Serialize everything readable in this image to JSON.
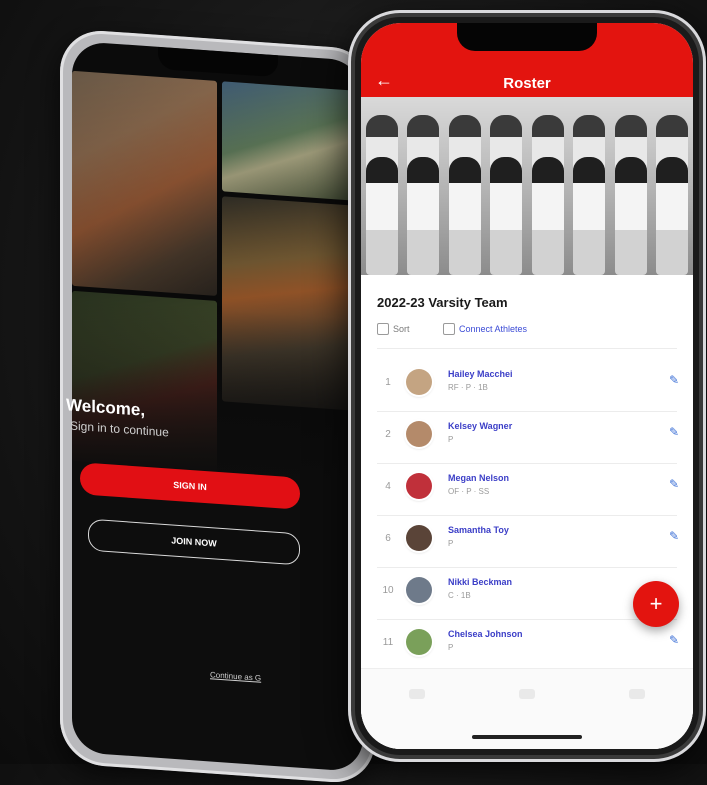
{
  "login": {
    "welcome": "Welcome,",
    "subtitle": "Sign in to continue",
    "sign_in": "SIGN IN",
    "join_now": "JOIN NOW",
    "continue_link": "Continue as G"
  },
  "roster": {
    "title": "Roster",
    "back_glyph": "←",
    "team_name": "2022-23 Varsity Team",
    "sort_label": "Sort",
    "connect_label": "Connect Athletes",
    "edit_glyph": "✎",
    "fab_glyph": "+",
    "players": [
      {
        "number": "1",
        "name": "Hailey Macchei",
        "position": "RF · P · 1B",
        "avatar_color": "#c4a482"
      },
      {
        "number": "2",
        "name": "Kelsey Wagner",
        "position": "P",
        "avatar_color": "#b48a6a"
      },
      {
        "number": "4",
        "name": "Megan Nelson",
        "position": "OF · P · SS",
        "avatar_color": "#c0303a"
      },
      {
        "number": "6",
        "name": "Samantha Toy",
        "position": "P",
        "avatar_color": "#5a4438"
      },
      {
        "number": "10",
        "name": "Nikki Beckman",
        "position": "C · 1B",
        "avatar_color": "#6e7a8a"
      },
      {
        "number": "11",
        "name": "Chelsea Johnson",
        "position": "P",
        "avatar_color": "#7aa05a"
      }
    ]
  },
  "colors": {
    "brand_red": "#e3140f",
    "link_blue": "#3b3ec7"
  }
}
